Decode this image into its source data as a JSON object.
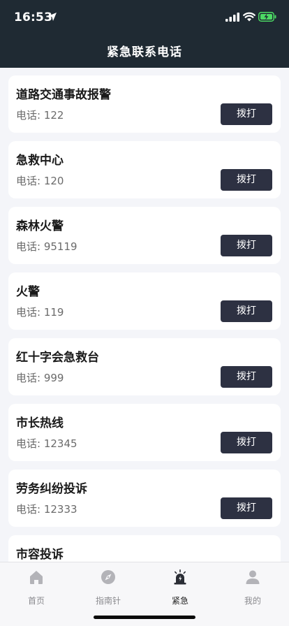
{
  "status_bar": {
    "time": "16:53"
  },
  "header": {
    "title": "紧急联系电话"
  },
  "contacts": [
    {
      "name": "道路交通事故报警",
      "phone": "电话: 122",
      "action": "拨打"
    },
    {
      "name": "急救中心",
      "phone": "电话: 120",
      "action": "拨打"
    },
    {
      "name": "森林火警",
      "phone": "电话: 95119",
      "action": "拨打"
    },
    {
      "name": "火警",
      "phone": "电话: 119",
      "action": "拨打"
    },
    {
      "name": "红十字会急救台",
      "phone": "电话: 999",
      "action": "拨打"
    },
    {
      "name": "市长热线",
      "phone": "电话: 12345",
      "action": "拨打"
    },
    {
      "name": "劳务纠纷投诉",
      "phone": "电话: 12333",
      "action": "拨打"
    },
    {
      "name": "市容投诉",
      "phone": "",
      "action": ""
    }
  ],
  "tabbar": {
    "tabs": [
      {
        "label": "首页",
        "icon": "home-icon"
      },
      {
        "label": "指南针",
        "icon": "compass-icon"
      },
      {
        "label": "紧急",
        "icon": "siren-icon",
        "active": true
      },
      {
        "label": "我的",
        "icon": "user-icon"
      }
    ]
  },
  "colors": {
    "header_bg": "#1f2a33",
    "page_bg": "#f4f5f9",
    "button_bg": "#2d3142",
    "battery_green": "#4cd964"
  }
}
